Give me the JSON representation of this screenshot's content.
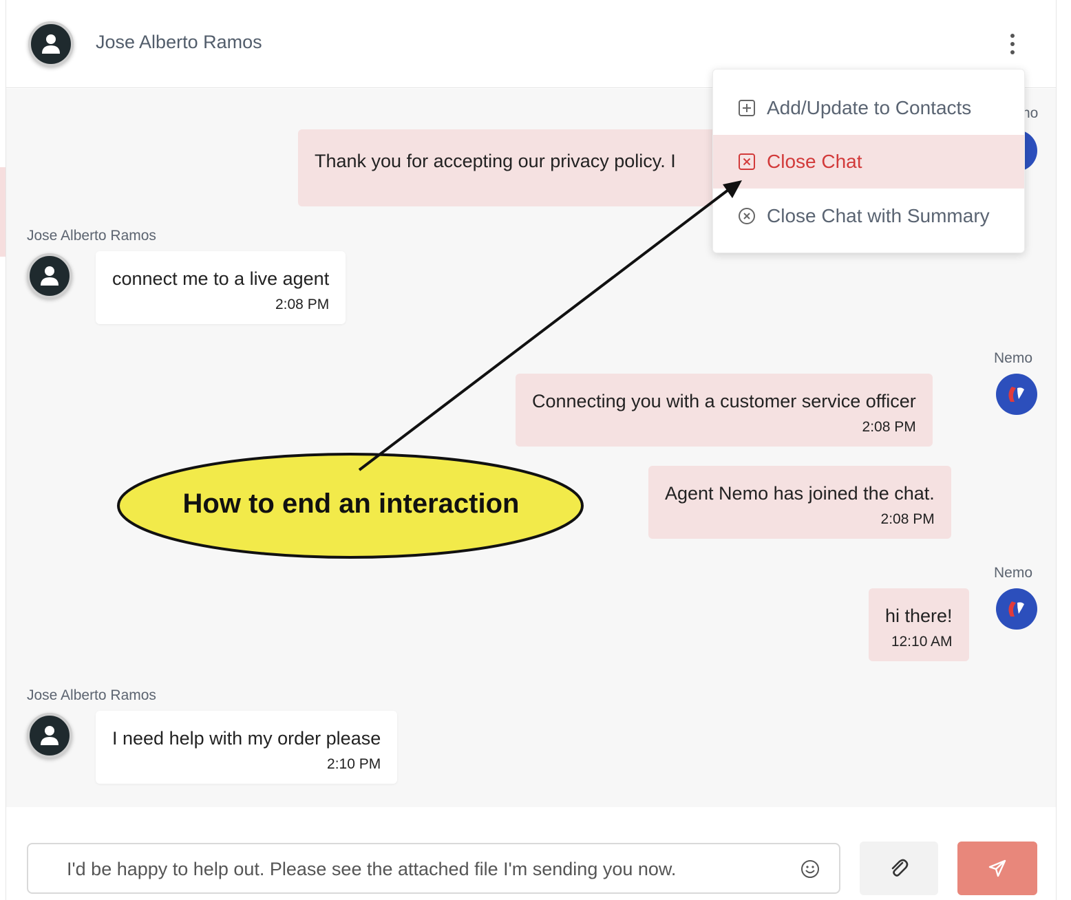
{
  "header": {
    "contact_name": "Jose Alberto Ramos",
    "avatar_icon": "user-icon",
    "menu_icon": "kebab-menu-icon"
  },
  "dropdown_menu": {
    "items": [
      {
        "label": "Add/Update to Contacts",
        "icon": "plus-square-icon"
      },
      {
        "label": "Close Chat",
        "icon": "x-square-icon"
      },
      {
        "label": "Close Chat with Summary",
        "icon": "x-circle-icon"
      }
    ]
  },
  "messages": [
    {
      "sender": "no",
      "text": "Thank you for accepting our privacy policy. I",
      "direction": "out"
    },
    {
      "sender": "Jose Alberto Ramos",
      "text": "connect me to a live agent",
      "time": "2:08 PM",
      "direction": "in"
    },
    {
      "sender": "Nemo",
      "text": "Connecting you with a customer service officer",
      "time": "2:08 PM",
      "direction": "out"
    },
    {
      "text": "Agent Nemo has joined the chat.",
      "time": "2:08 PM",
      "direction": "out"
    },
    {
      "sender": "Nemo",
      "text": "hi there!",
      "time": "12:10 AM",
      "direction": "out"
    },
    {
      "sender": "Jose Alberto Ramos",
      "text": "I need help with my order please",
      "time": "2:10 PM",
      "direction": "in"
    }
  ],
  "composer": {
    "value": "I'd be happy to help out. Please see the attached file I'm sending you now.",
    "emoji_icon": "smiley-icon",
    "attach_icon": "paperclip-icon",
    "send_icon": "send-icon"
  },
  "annotation": {
    "callout_text": "How to end an interaction"
  },
  "colors": {
    "outgoing_bubble": "#f5e1e1",
    "danger": "#d23a3a",
    "send_button": "#e8877b",
    "bot_avatar": "#2c4fbc",
    "callout_fill": "#f2ea4a"
  }
}
